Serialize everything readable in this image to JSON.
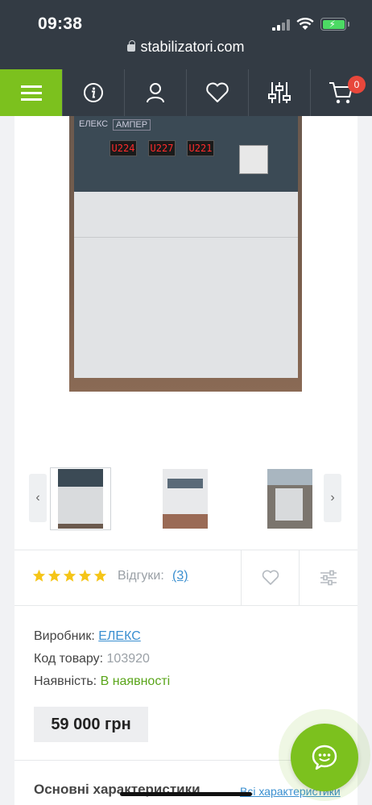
{
  "status_bar": {
    "time": "09:38",
    "url": "stabilizatori.com"
  },
  "nav": {
    "items": [
      {
        "name": "menu",
        "icon": "hamburger-icon"
      },
      {
        "name": "info",
        "icon": "info-icon"
      },
      {
        "name": "account",
        "icon": "user-icon"
      },
      {
        "name": "wishlist",
        "icon": "heart-icon"
      },
      {
        "name": "filters",
        "icon": "sliders-icon"
      },
      {
        "name": "cart",
        "icon": "cart-icon"
      }
    ],
    "cart_count": "0",
    "accent": "#7cc11e",
    "background": "#333b44"
  },
  "product": {
    "photo_panel": {
      "brand": "ЕЛЕКС",
      "model": "АМПЕР",
      "readouts": [
        "U224",
        "U227",
        "U221"
      ]
    },
    "thumbnails": [
      "thumb-1",
      "thumb-2",
      "thumb-3"
    ],
    "rating": {
      "stars": 5,
      "reviews_label": "Відгуки:",
      "reviews_count": "(3)"
    },
    "details": {
      "manufacturer_label": "Виробник:",
      "manufacturer_value": "ЕЛЕКС",
      "code_label": "Код товару:",
      "code_value": "103920",
      "availability_label": "Наявність:",
      "availability_value": "В наявності"
    },
    "price": "59 000 грн"
  },
  "section": {
    "title": "Основні характеристики",
    "link": "Всі характеристики"
  },
  "colors": {
    "star": "#f5c518",
    "link": "#3a8fd0",
    "in_stock": "#5aa51a",
    "badge": "#e8473b"
  }
}
